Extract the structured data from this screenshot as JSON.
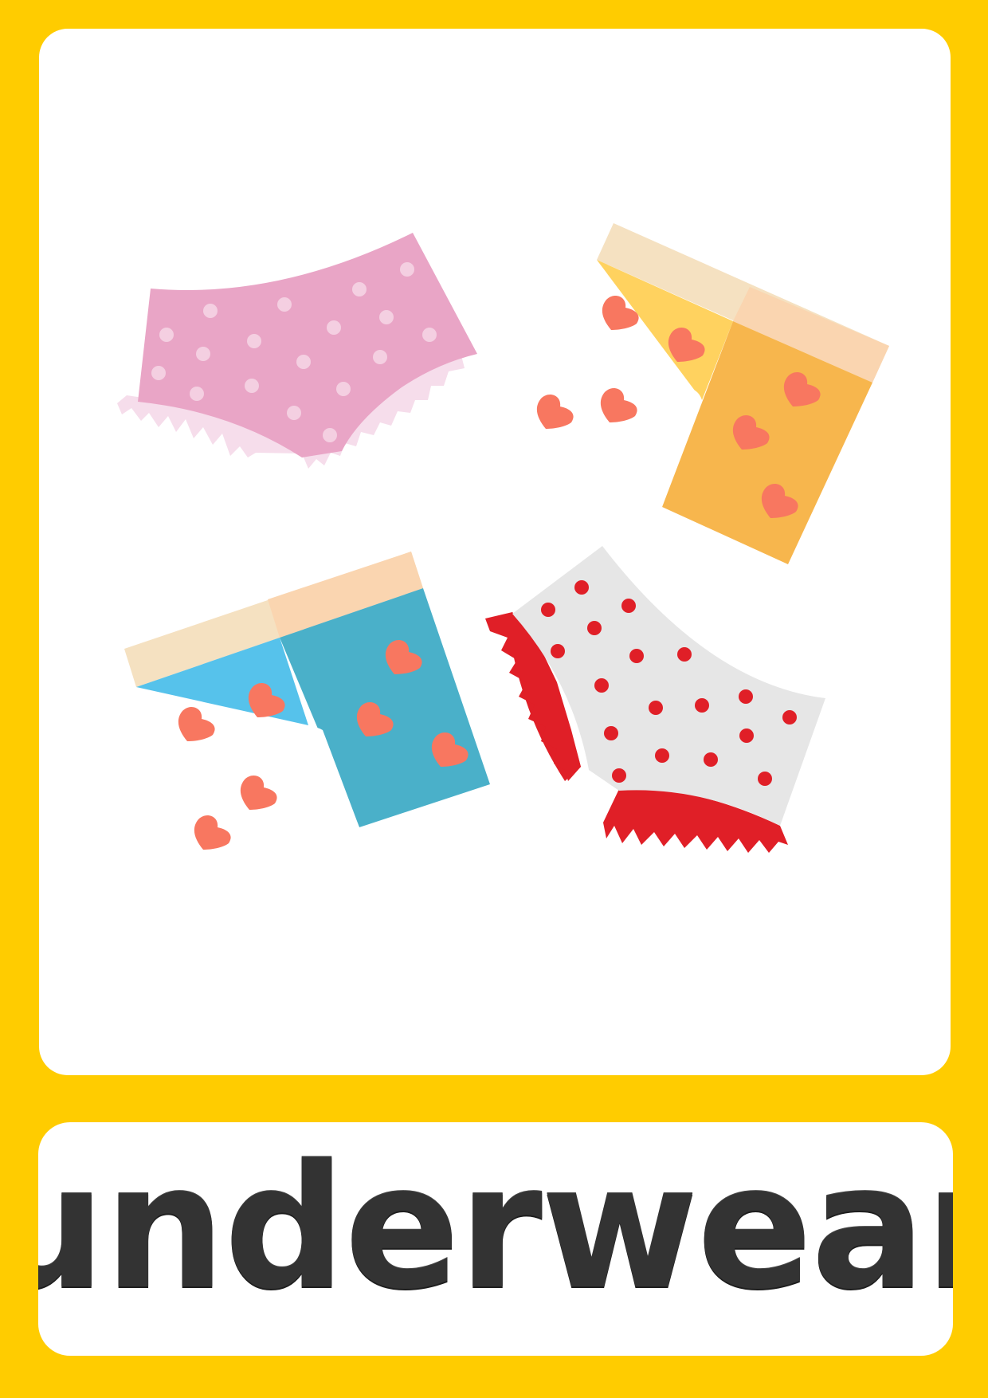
{
  "card": {
    "word": "underwear",
    "frame_color": "#FFCC00",
    "panel_color": "#FFFFFF",
    "text_color": "#333333"
  },
  "illustration": {
    "items": [
      {
        "name": "pink-polka-dot-panties-icon",
        "body_color": "#E9A5C6",
        "trim_color": "#F6DDEB",
        "dot_color": "#F4CFE1"
      },
      {
        "name": "yellow-heart-boxers-icon",
        "body_color": "#FFD25F",
        "body_shade": "#F7B64D",
        "band_color": "#F5E1C1",
        "heart_color": "#F87760"
      },
      {
        "name": "blue-heart-boxers-icon",
        "body_color": "#56C2EB",
        "body_shade": "#4AB0C9",
        "band_color": "#F5E1C1",
        "heart_color": "#F87760"
      },
      {
        "name": "white-red-dot-panties-icon",
        "body_color": "#E6E6E6",
        "trim_color": "#E01F27",
        "dot_color": "#E01F27"
      }
    ]
  }
}
